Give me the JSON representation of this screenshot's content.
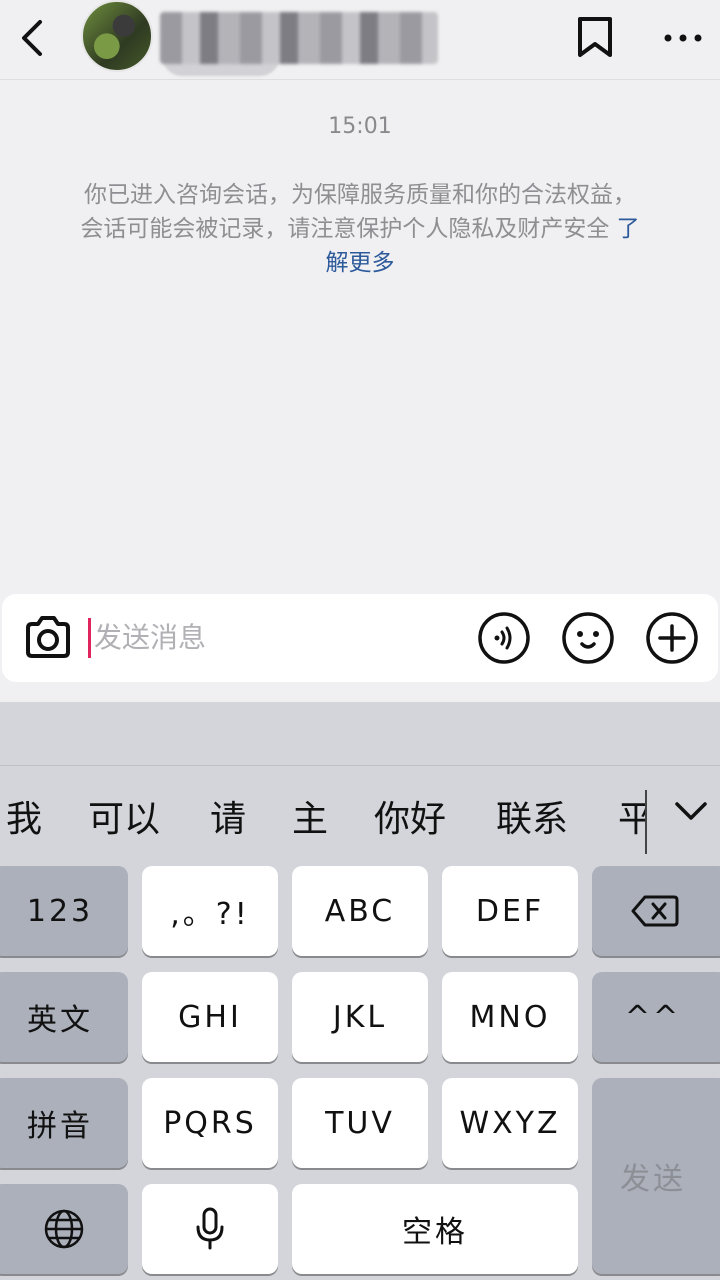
{
  "header": {
    "contact_name": "",
    "icons": [
      "chevron-left-icon",
      "avatar",
      "bookmark-icon",
      "more-icon"
    ]
  },
  "chat": {
    "timestamp": "15:01",
    "notice_text": "你已进入咨询会话，为保障服务质量和你的合法权益，会话可能会被记录，请注意保护个人隐私及财产安全",
    "notice_link": "了解更多"
  },
  "input_bar": {
    "placeholder": "发送消息",
    "value": "",
    "icons": [
      "camera-icon",
      "voice-icon",
      "emoji-icon",
      "plus-icon"
    ]
  },
  "keyboard": {
    "candidates": [
      "我",
      "可以",
      "请",
      "主",
      "你好",
      "联系",
      "平"
    ],
    "keys": {
      "num": "123",
      "punct": ",。?!",
      "abc": "ABC",
      "def": "DEF",
      "english": "英文",
      "ghi": "GHI",
      "jkl": "JKL",
      "mno": "MNO",
      "emoticon": "^^",
      "pinyin": "拼音",
      "pqrs": "PQRS",
      "tuv": "TUV",
      "wxyz": "WXYZ",
      "send": "发送",
      "space": "空格"
    }
  },
  "colors": {
    "background": "#f0f0f2",
    "caret": "#e0245e",
    "link": "#2d5a9b",
    "keyboard_bg": "#d3d5db",
    "function_key": "#abb0bb"
  }
}
